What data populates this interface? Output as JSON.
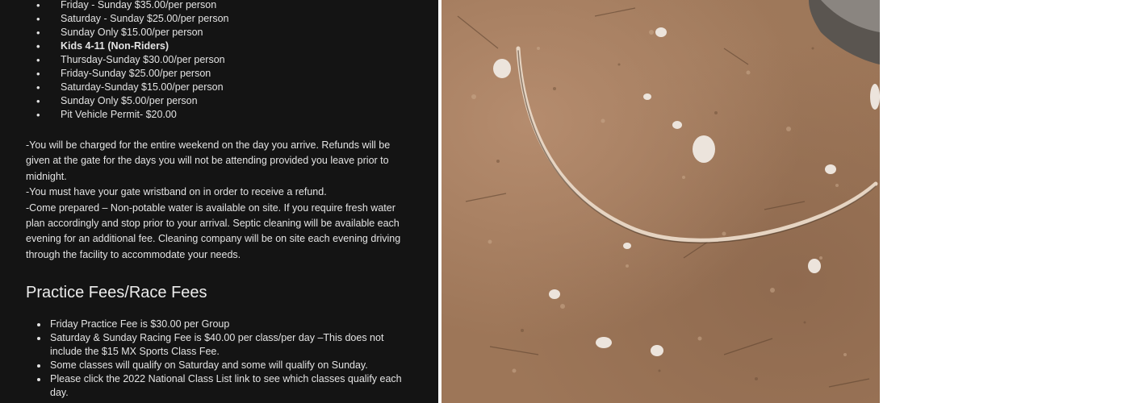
{
  "admission_list": [
    {
      "text": "Friday - Sunday  $35.00/per person",
      "bold": false
    },
    {
      "text": "Saturday - Sunday  $25.00/per person",
      "bold": false
    },
    {
      "text": "Sunday Only $15.00/per person",
      "bold": false
    },
    {
      "text": "Kids 4-11 (Non-Riders)",
      "bold": true
    },
    {
      "text": "Thursday-Sunday $30.00/per person",
      "bold": false
    },
    {
      "text": "Friday-Sunday $25.00/per person",
      "bold": false
    },
    {
      "text": "Saturday-Sunday $15.00/per person",
      "bold": false
    },
    {
      "text": "Sunday Only $5.00/per person",
      "bold": false
    },
    {
      "text": "Pit Vehicle Permit- $20.00",
      "bold": false
    }
  ],
  "notes": [
    "-You will be charged for the entire weekend on the day you arrive.  Refunds will be given at the gate for the days you will not be attending provided you leave prior to midnight.",
    "-You must have your gate wristband on in order to receive a refund.",
    "-Come prepared – Non-potable water is available on site. If you require fresh water plan accordingly and stop prior to your arrival. Septic cleaning will be available each evening for an additional fee.  Cleaning company will be on site each evening driving through the facility to accommodate your needs."
  ],
  "fees_heading": "Practice Fees/Race Fees",
  "fees_list": [
    "Friday Practice Fee is $30.00 per Group",
    "Saturday & Sunday Racing Fee is $40.00 per class/per day –This does not include the $15 MX  Sports Class Fee.",
    "Some classes will qualify on Saturday and some will qualify on Sunday.",
    "Please click the 2022 National Class List link to see which classes qualify each day."
  ],
  "photo": {
    "icon": "dirt-ground-with-stick-photo"
  },
  "colors": {
    "panel_bg": "#141414",
    "text": "#e3e3e3",
    "dirt": "#9d7658"
  }
}
